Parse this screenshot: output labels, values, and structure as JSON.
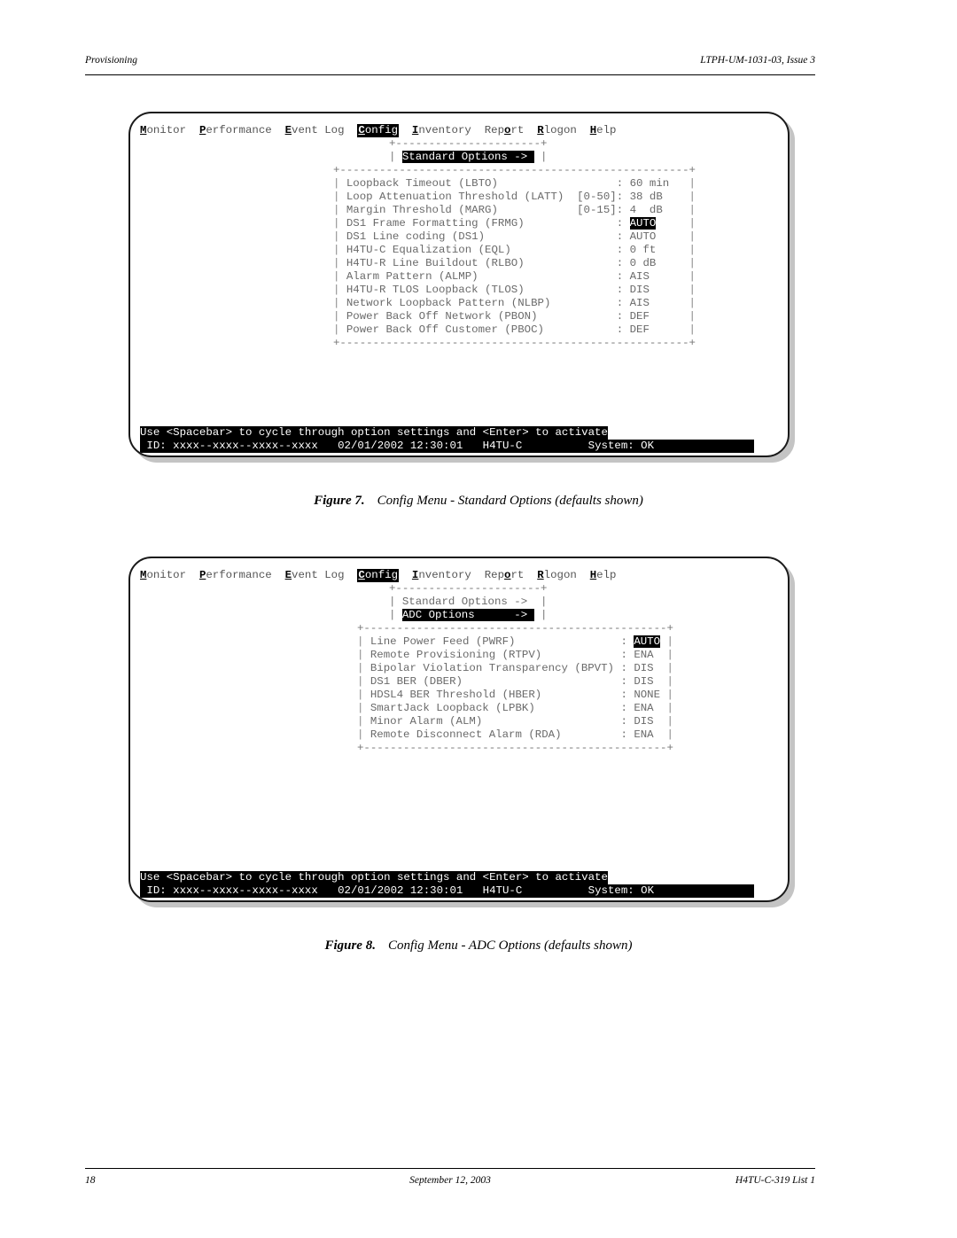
{
  "page_header": {
    "section": "Provisioning",
    "doc_id": "LTPH-UM-1031-03, Issue 3"
  },
  "menu": [
    {
      "hot": "M",
      "rest": "onitor",
      "active": false
    },
    {
      "hot": "P",
      "rest": "erformance",
      "active": false
    },
    {
      "hot": "E",
      "rest": "vent Log",
      "active": false
    },
    {
      "hot": "C",
      "rest": "onfig",
      "active": true
    },
    {
      "hot": "I",
      "rest": "nventory",
      "active": false
    },
    {
      "pre": "Rep",
      "hot": "o",
      "rest": "rt",
      "active": false
    },
    {
      "hot": "R",
      "rest": "logon",
      "active": false
    },
    {
      "hot": "H",
      "rest": "elp",
      "active": false
    }
  ],
  "figures": [
    {
      "submenu": {
        "top_border": "+----------------------+",
        "items": [
          {
            "label": "Standard Options ->",
            "selected": true
          }
        ]
      },
      "options_border": "+-----------------------------------------------------+",
      "options": [
        {
          "label": "Loopback Timeout (LBTO)",
          "range": "",
          "value": "60 min",
          "selected": false
        },
        {
          "label": "Loop Attenuation Threshold (LATT)",
          "range": "[0-50]",
          "value": "38 dB",
          "selected": false
        },
        {
          "label": "Margin Threshold (MARG)",
          "range": "[0-15]",
          "value": "4  dB",
          "selected": false
        },
        {
          "label": "DS1 Frame Formatting (FRMG)",
          "range": "",
          "value": "AUTO",
          "selected": true
        },
        {
          "label": "DS1 Line coding (DS1)",
          "range": "",
          "value": "AUTO",
          "selected": false
        },
        {
          "label": "H4TU-C Equalization (EQL)",
          "range": "",
          "value": "0 ft",
          "selected": false
        },
        {
          "label": "H4TU-R Line Buildout (RLBO)",
          "range": "",
          "value": "0 dB",
          "selected": false
        },
        {
          "label": "Alarm Pattern (ALMP)",
          "range": "",
          "value": "AIS",
          "selected": false
        },
        {
          "label": "H4TU-R TLOS Loopback (TLOS)",
          "range": "",
          "value": "DIS",
          "selected": false
        },
        {
          "label": "Network Loopback Pattern (NLBP)",
          "range": "",
          "value": "AIS",
          "selected": false
        },
        {
          "label": "Power Back Off Network (PBON)",
          "range": "",
          "value": "DEF",
          "selected": false
        },
        {
          "label": "Power Back Off Customer (PBOC)",
          "range": "",
          "value": "DEF",
          "selected": false
        }
      ],
      "help_text": "Use <Spacebar> to cycle through option settings and <Enter> to activate",
      "status": {
        "id": " ID: xxxx--xxxx--xxxx--xxxx",
        "datetime": "02/01/2002 12:30:01",
        "unit": "H4TU-C",
        "system": "System: OK"
      },
      "caption_num": "Figure 7.",
      "caption_text": "Config Menu - Standard Options (defaults shown)"
    },
    {
      "submenu": {
        "top_border": "+----------------------+",
        "items": [
          {
            "label": "Standard Options ->",
            "selected": false
          },
          {
            "label": "ADC Options      ->",
            "selected": true
          }
        ]
      },
      "options_border": "+----------------------------------------------+",
      "options": [
        {
          "label": "Line Power Feed (PWRF)",
          "range": "",
          "value": "AUTO",
          "selected": true
        },
        {
          "label": "Remote Provisioning (RTPV)",
          "range": "",
          "value": "ENA",
          "selected": false
        },
        {
          "label": "Bipolar Violation Transparency (BPVT)",
          "range": "",
          "value": "DIS",
          "selected": false
        },
        {
          "label": "DS1 BER (DBER)",
          "range": "",
          "value": "DIS",
          "selected": false
        },
        {
          "label": "HDSL4 BER Threshold (HBER)",
          "range": "",
          "value": "NONE",
          "selected": false
        },
        {
          "label": "SmartJack Loopback (LPBK)",
          "range": "",
          "value": "ENA",
          "selected": false
        },
        {
          "label": "Minor Alarm (ALM)",
          "range": "",
          "value": "DIS",
          "selected": false
        },
        {
          "label": "Remote Disconnect Alarm (RDA)",
          "range": "",
          "value": "ENA",
          "selected": false
        }
      ],
      "help_text": "Use <Spacebar> to cycle through option settings and <Enter> to activate",
      "status": {
        "id": " ID: xxxx--xxxx--xxxx--xxxx",
        "datetime": "02/01/2002 12:30:01",
        "unit": "H4TU-C",
        "system": "System: OK"
      },
      "caption_num": "Figure 8.",
      "caption_text": "Config Menu - ADC Options (defaults shown)"
    }
  ],
  "page_footer": {
    "page_number": "18",
    "date": "September 12, 2003",
    "product": "H4TU-C-319 List 1"
  }
}
